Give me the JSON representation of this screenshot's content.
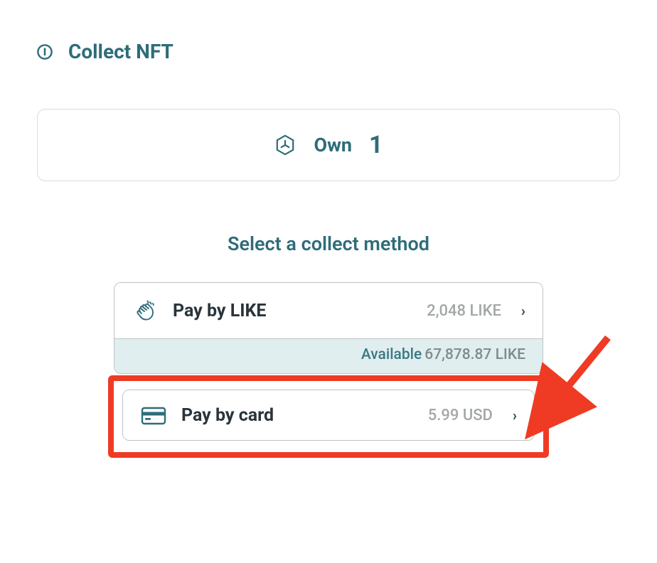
{
  "header": {
    "title": "Collect NFT"
  },
  "own": {
    "label": "Own",
    "count": "1"
  },
  "select_heading": "Select a collect method",
  "methods": {
    "like": {
      "label": "Pay by LIKE",
      "price": "2,048 LIKE",
      "available_label": "Available",
      "available_amount": "67,878.87 LIKE"
    },
    "card": {
      "label": "Pay by card",
      "price": "5.99 USD"
    }
  }
}
